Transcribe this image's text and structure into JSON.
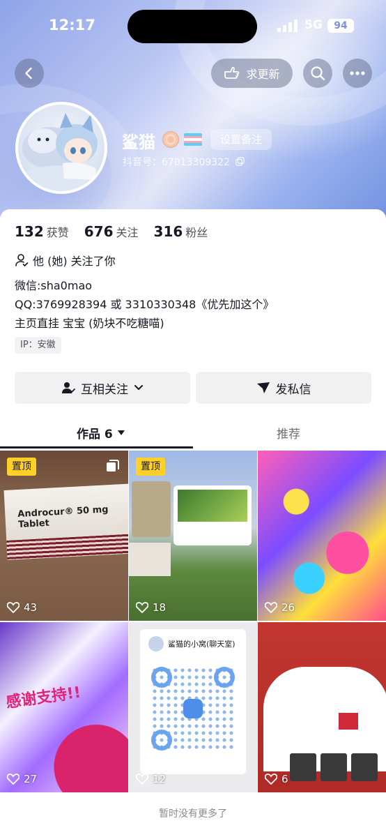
{
  "status_bar": {
    "time": "12:17",
    "network": "5G",
    "battery": "94"
  },
  "nav": {
    "update_request_label": "求更新"
  },
  "profile": {
    "name": "鲨猫",
    "remark_button": "设置备注",
    "douyin_id": "抖音号：67013309322"
  },
  "stats": [
    {
      "value": "132",
      "label": "获赞"
    },
    {
      "value": "676",
      "label": "关注"
    },
    {
      "value": "316",
      "label": "粉丝"
    }
  ],
  "follows_you": "他 (她) 关注了你",
  "bio_lines": [
    "微信:sha0mao",
    "QQ:3769928394 或 3310330348《优先加这个》",
    "主页直挂  宝宝  (奶块不吃糖喵)"
  ],
  "ip_location": "IP：安徽",
  "actions": {
    "mutual_follow": "互相关注",
    "message": "发私信"
  },
  "tabs": {
    "works": "作品 6",
    "recommend": "推荐"
  },
  "posts": [
    {
      "pinned": "置顶",
      "likes": "43",
      "caption": "Androcur® 50 mg Tablet"
    },
    {
      "pinned": "置顶",
      "likes": "18",
      "caption": ""
    },
    {
      "likes": "26"
    },
    {
      "likes": "27",
      "caption": "感谢支持!!"
    },
    {
      "likes": "12",
      "caption": "鲨猫的小窝(聊天室)"
    },
    {
      "likes": "6"
    }
  ],
  "footer": "暂时没有更多了",
  "colors": {
    "accent_yellow": "#ffd028",
    "header_blue": "#8fa4e8"
  }
}
